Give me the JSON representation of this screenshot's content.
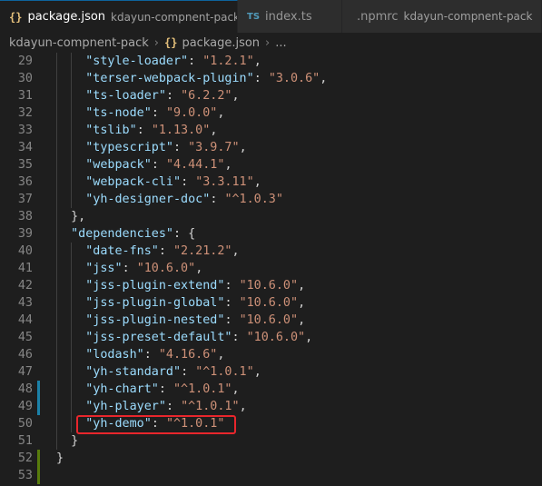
{
  "tabs": [
    {
      "icon": "{}",
      "label": "package.json",
      "description": "kdayun-compnent-pack",
      "close": "✕",
      "active": true
    },
    {
      "icon": "TS",
      "label": "index.ts",
      "description": "",
      "active": false
    },
    {
      "icon": "npm",
      "label": ".npmrc",
      "description": "kdayun-compnent-pack",
      "active": false
    }
  ],
  "breadcrumb": {
    "folder": "kdayun-compnent-pack",
    "file_icon": "{}",
    "file": "package.json",
    "more": "..."
  },
  "lines": [
    {
      "n": "29",
      "indent": "    ",
      "key": "\"style-loader\"",
      "val": "\"1.2.1\"",
      "tail": ","
    },
    {
      "n": "30",
      "indent": "    ",
      "key": "\"terser-webpack-plugin\"",
      "val": "\"3.0.6\"",
      "tail": ","
    },
    {
      "n": "31",
      "indent": "    ",
      "key": "\"ts-loader\"",
      "val": "\"6.2.2\"",
      "tail": ","
    },
    {
      "n": "32",
      "indent": "    ",
      "key": "\"ts-node\"",
      "val": "\"9.0.0\"",
      "tail": ","
    },
    {
      "n": "33",
      "indent": "    ",
      "key": "\"tslib\"",
      "val": "\"1.13.0\"",
      "tail": ","
    },
    {
      "n": "34",
      "indent": "    ",
      "key": "\"typescript\"",
      "val": "\"3.9.7\"",
      "tail": ","
    },
    {
      "n": "35",
      "indent": "    ",
      "key": "\"webpack\"",
      "val": "\"4.44.1\"",
      "tail": ","
    },
    {
      "n": "36",
      "indent": "    ",
      "key": "\"webpack-cli\"",
      "val": "\"3.3.11\"",
      "tail": ","
    },
    {
      "n": "37",
      "indent": "    ",
      "key": "\"yh-designer-doc\"",
      "val": "\"^1.0.3\"",
      "tail": ""
    },
    {
      "n": "38",
      "indent": "  ",
      "key": "",
      "val": "",
      "tail": "},"
    },
    {
      "n": "39",
      "indent": "  ",
      "key": "\"dependencies\"",
      "val": "",
      "tail": " {"
    },
    {
      "n": "40",
      "indent": "    ",
      "key": "\"date-fns\"",
      "val": "\"2.21.2\"",
      "tail": ","
    },
    {
      "n": "41",
      "indent": "    ",
      "key": "\"jss\"",
      "val": "\"10.6.0\"",
      "tail": ","
    },
    {
      "n": "42",
      "indent": "    ",
      "key": "\"jss-plugin-extend\"",
      "val": "\"10.6.0\"",
      "tail": ","
    },
    {
      "n": "43",
      "indent": "    ",
      "key": "\"jss-plugin-global\"",
      "val": "\"10.6.0\"",
      "tail": ","
    },
    {
      "n": "44",
      "indent": "    ",
      "key": "\"jss-plugin-nested\"",
      "val": "\"10.6.0\"",
      "tail": ","
    },
    {
      "n": "45",
      "indent": "    ",
      "key": "\"jss-preset-default\"",
      "val": "\"10.6.0\"",
      "tail": ","
    },
    {
      "n": "46",
      "indent": "    ",
      "key": "\"lodash\"",
      "val": "\"4.16.6\"",
      "tail": ","
    },
    {
      "n": "47",
      "indent": "    ",
      "key": "\"yh-standard\"",
      "val": "\"^1.0.1\"",
      "tail": ","
    },
    {
      "n": "48",
      "indent": "    ",
      "key": "\"yh-chart\"",
      "val": "\"^1.0.1\"",
      "tail": ","
    },
    {
      "n": "49",
      "indent": "    ",
      "key": "\"yh-player\"",
      "val": "\"^1.0.1\"",
      "tail": ","
    },
    {
      "n": "50",
      "indent": "    ",
      "key": "\"yh-demo\"",
      "val": "\"^1.0.1\"",
      "tail": ""
    },
    {
      "n": "51",
      "indent": "  ",
      "key": "",
      "val": "",
      "tail": "}"
    },
    {
      "n": "52",
      "indent": "",
      "key": "",
      "val": "",
      "tail": "}"
    },
    {
      "n": "53",
      "indent": "",
      "key": "",
      "val": "",
      "tail": ""
    }
  ],
  "colors": {
    "background": "#1e1e1e",
    "key": "#9cdcfe",
    "string": "#ce9178",
    "line_number": "#858585",
    "highlight_box": "#e8262c",
    "gutter_modified": "#1b81a8",
    "gutter_added": "#587c0c"
  }
}
